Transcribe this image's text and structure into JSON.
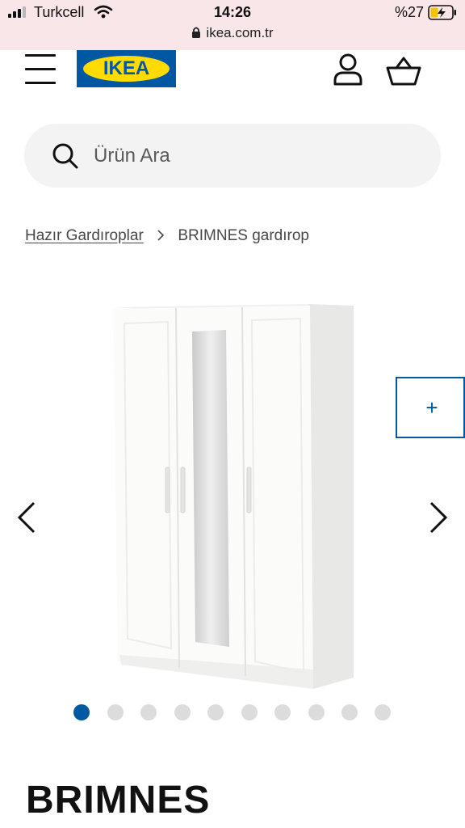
{
  "status_bar": {
    "carrier": "Turkcell",
    "time": "14:26",
    "battery": "%27",
    "url": "ikea.com.tr",
    "icons": [
      "signal-icon",
      "wifi-icon",
      "battery-charging-icon",
      "lock-icon"
    ]
  },
  "header": {
    "logo_text": "IKEA",
    "icons": [
      "menu-icon",
      "profile-icon",
      "cart-icon"
    ]
  },
  "search": {
    "placeholder": "Ürün Ara",
    "icon": "search-icon"
  },
  "breadcrumb": {
    "parent": "Hazır Gardıroplar",
    "current": "BRIMNES gardırop"
  },
  "gallery": {
    "zoom_label": "+",
    "image_count": 10,
    "active_index": 0
  },
  "product": {
    "name": "BRIMNES"
  },
  "colors": {
    "brand_blue": "#0058a3",
    "brand_yellow": "#ffdb00",
    "status_bar_bg": "#f9e6e9",
    "search_bg": "#f3f3f3"
  }
}
